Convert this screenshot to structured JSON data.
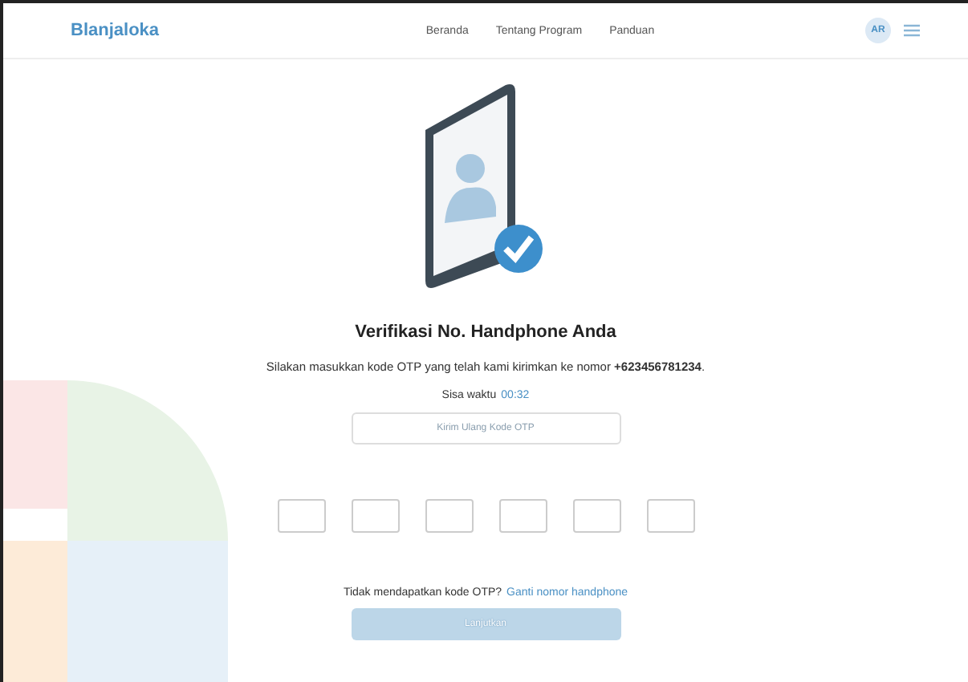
{
  "header": {
    "logo": "Blanjaloka",
    "nav": [
      {
        "label": "Beranda"
      },
      {
        "label": "Tentang Program"
      },
      {
        "label": "Panduan"
      }
    ],
    "avatar": "AR"
  },
  "verification": {
    "title": "Verifikasi No. Handphone Anda",
    "message": "Silakan masukkan kode OTP yang telah kami kirimkan ke nomor **+623456781234**.",
    "timer_label": "Sisa waktu",
    "timer": "00:32",
    "resend_button": {
      "label": "Kirim Ulang Kode OTP",
      "disabled": true
    },
    "otp_inputs": [
      {
        "kind": "digit"
      },
      {
        "kind": "digit"
      },
      {
        "kind": "digit"
      },
      {
        "kind": "digit"
      },
      {
        "kind": "digit"
      },
      {
        "kind": "digit"
      }
    ],
    "help_text": "Tidak mendapatkan kode OTP?",
    "help_link": "Ganti nomor handphone",
    "submit_button": {
      "label": "Lanjutkan",
      "disabled": true
    }
  }
}
